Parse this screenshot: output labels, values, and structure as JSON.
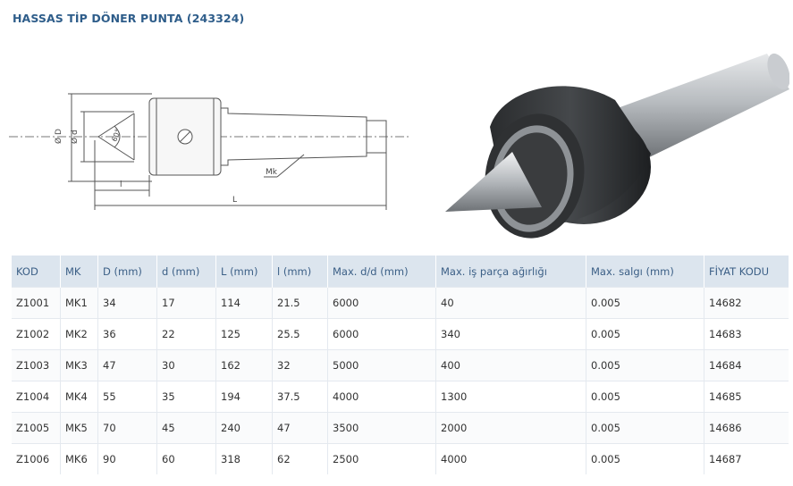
{
  "title": "HASSAS TİP DÖNER PUNTA (243324)",
  "drawing": {
    "dim_D": "Ø D",
    "dim_d": "Ø d",
    "angle": "60°",
    "dim_l": "l",
    "dim_L": "L",
    "taper": "Mk"
  },
  "table": {
    "headers": [
      "KOD",
      "MK",
      "D (mm)",
      "d (mm)",
      "L (mm)",
      "l (mm)",
      "Max. d/d (mm)",
      "Max. iş parça ağırlığı",
      "Max. salgı (mm)",
      "FİYAT KODU"
    ],
    "rows": [
      [
        "Z1001",
        "MK1",
        "34",
        "17",
        "114",
        "21.5",
        "6000",
        "40",
        "0.005",
        "14682"
      ],
      [
        "Z1002",
        "MK2",
        "36",
        "22",
        "125",
        "25.5",
        "6000",
        "340",
        "0.005",
        "14683"
      ],
      [
        "Z1003",
        "MK3",
        "47",
        "30",
        "162",
        "32",
        "5000",
        "400",
        "0.005",
        "14684"
      ],
      [
        "Z1004",
        "MK4",
        "55",
        "35",
        "194",
        "37.5",
        "4000",
        "1300",
        "0.005",
        "14685"
      ],
      [
        "Z1005",
        "MK5",
        "70",
        "45",
        "240",
        "47",
        "3500",
        "2000",
        "0.005",
        "14686"
      ],
      [
        "Z1006",
        "MK6",
        "90",
        "60",
        "318",
        "62",
        "2500",
        "4000",
        "0.005",
        "14687"
      ]
    ]
  }
}
